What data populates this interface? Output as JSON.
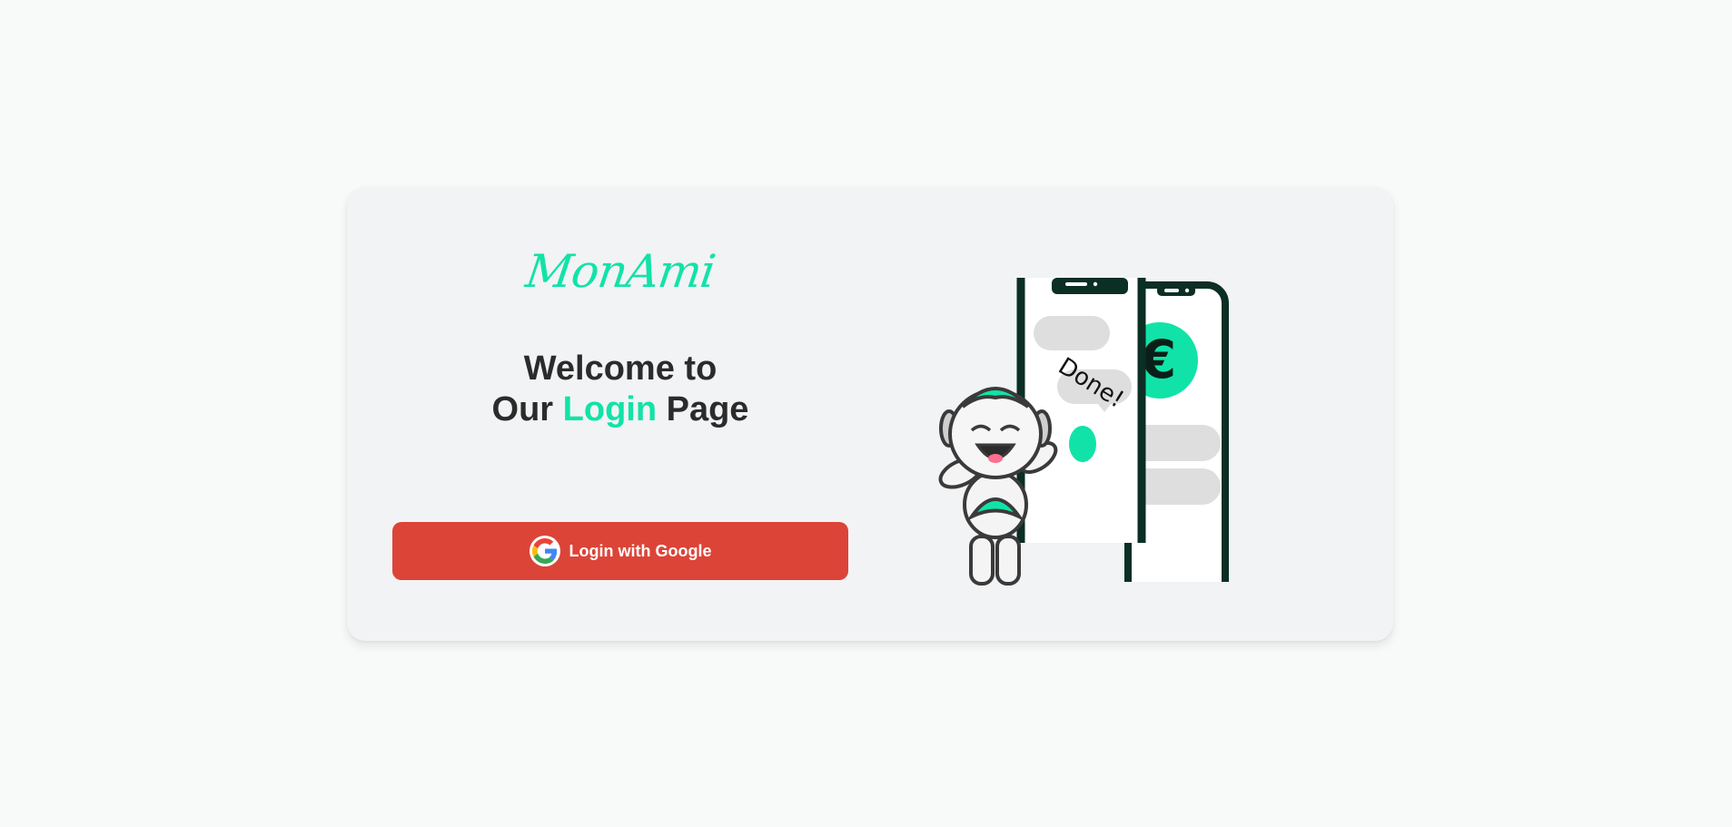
{
  "brand": {
    "logo_text": "MonAmi",
    "accent_color": "#11e3a8"
  },
  "headline": {
    "line1": "Welcome to",
    "line2_prefix": "Our ",
    "line2_accent": "Login",
    "line2_suffix": " Page"
  },
  "login": {
    "button_label": "Login with Google",
    "button_color": "#dc4438",
    "icon": "google-g-icon"
  },
  "illustration": {
    "speech_text": "Done!",
    "currency_symbol": "€",
    "icons": [
      "robot-mascot",
      "phone",
      "euro-icon"
    ]
  }
}
